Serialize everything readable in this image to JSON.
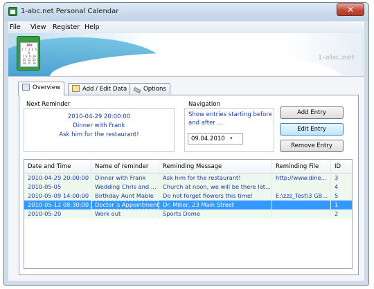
{
  "window": {
    "title": "1-abc.net Personal Calendar",
    "close_glyph": "✕"
  },
  "menu": {
    "file": "File",
    "view": "View",
    "register": "Register",
    "help": "Help"
  },
  "banner": {
    "logo": {
      "month": "JAN",
      "rows": [
        "1 2 3 4 5 6",
        "7 8 9 10",
        "11 12 13",
        "14 15 16"
      ]
    },
    "brand": "1-abc.net"
  },
  "tabs": [
    {
      "label": "Overview",
      "icon": "overview-icon",
      "active": true
    },
    {
      "label": "Add / Edit Data",
      "icon": "edit-data-icon",
      "active": false
    },
    {
      "label": "Options",
      "icon": "wrench-icon",
      "active": false
    }
  ],
  "next_reminder": {
    "heading": "Next Reminder",
    "datetime": "2010-04-29 20:00:00",
    "name": "Dinner with Frank",
    "message": "Ask him for the restaurant!"
  },
  "navigation": {
    "heading": "Navigation",
    "text": "Show entries starting before and after ...",
    "date_value": "09.04.2010",
    "picker_glyph": "▾"
  },
  "buttons": {
    "add": "Add Entry",
    "edit": "Edit Entry",
    "remove": "Remove Entry"
  },
  "table": {
    "columns": [
      "Date and Time",
      "Name of reminder",
      "Reminding Message",
      "Reminding File",
      "ID"
    ],
    "rows": [
      [
        "2010-04-29 20:00:00",
        "Dinner with Frank",
        "Ask him for the restaurant!",
        "http://www.dine...",
        "3"
      ],
      [
        "2010-05-05",
        "Wedding Chris and ...",
        "Church at noon, we will be there lat...",
        "",
        "4"
      ],
      [
        "2010-05-09 14:00:00",
        "Birthday Aunt Mable",
        "Do not forget flowers this time!",
        "E:\\zzz_Test\\3 GB...",
        "5"
      ],
      [
        "2010-05-12 08:30:00",
        "Doctor´s Appointment",
        "Dr. Miller, 23 Main Street",
        "",
        "1"
      ],
      [
        "2010-05-20",
        "Work out",
        "Sports Dome",
        "",
        "2"
      ]
    ],
    "selected_row": 3
  },
  "colors": {
    "accent": "#3399ff",
    "link_text": "#1a3aa0",
    "row_tint": "#eef8ee"
  }
}
